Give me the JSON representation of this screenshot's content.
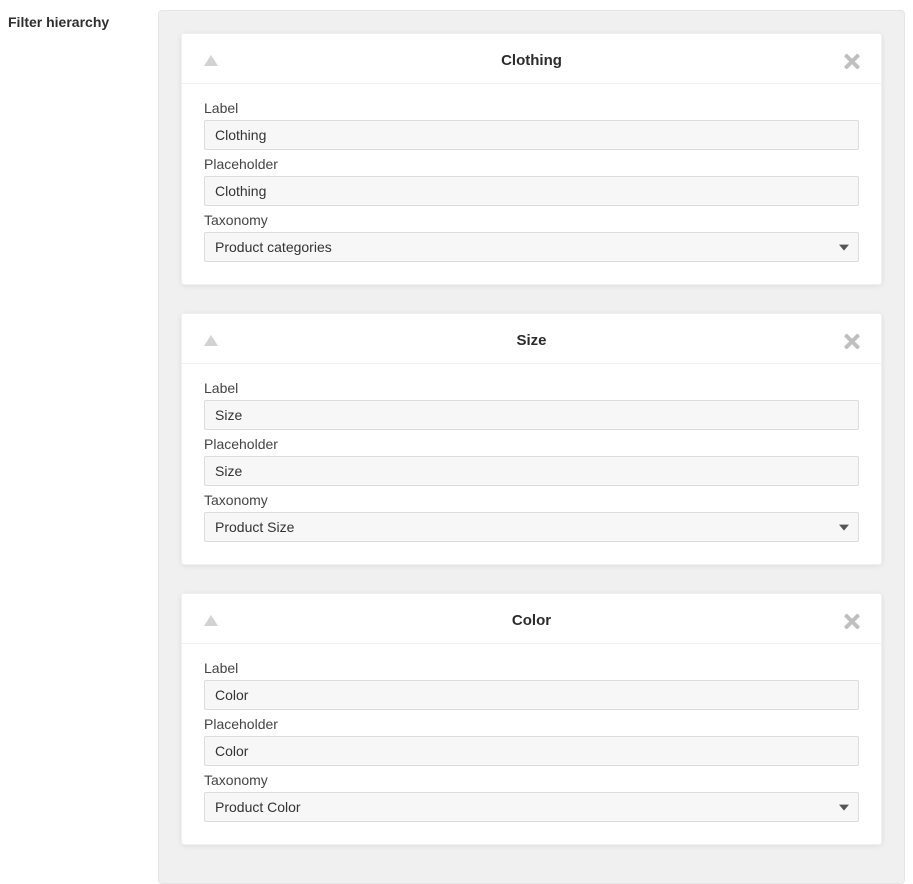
{
  "sectionLabel": "Filter hierarchy",
  "fieldLabels": {
    "label": "Label",
    "placeholder": "Placeholder",
    "taxonomy": "Taxonomy"
  },
  "filters": [
    {
      "title": "Clothing",
      "labelValue": "Clothing",
      "placeholderValue": "Clothing",
      "taxonomyValue": "Product categories"
    },
    {
      "title": "Size",
      "labelValue": "Size",
      "placeholderValue": "Size",
      "taxonomyValue": "Product Size"
    },
    {
      "title": "Color",
      "labelValue": "Color",
      "placeholderValue": "Color",
      "taxonomyValue": "Product Color"
    }
  ]
}
